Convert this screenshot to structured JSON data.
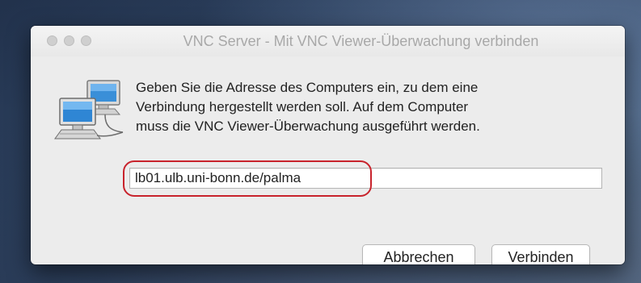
{
  "window": {
    "title": "VNC Server - Mit VNC Viewer-Überwachung verbinden"
  },
  "dialog": {
    "icon": "network-computers-icon",
    "message_lines": [
      "Geben Sie die Adresse des Computers ein, zu dem eine",
      "Verbindung hergestellt werden soll. Auf dem Computer",
      "muss die VNC Viewer-Überwachung ausgeführt werden."
    ],
    "address_value": "lb01.ulb.uni-bonn.de/palma",
    "highlight_color": "#c8232c"
  },
  "buttons": {
    "cancel_label": "Abbrechen",
    "connect_label": "Verbinden"
  }
}
